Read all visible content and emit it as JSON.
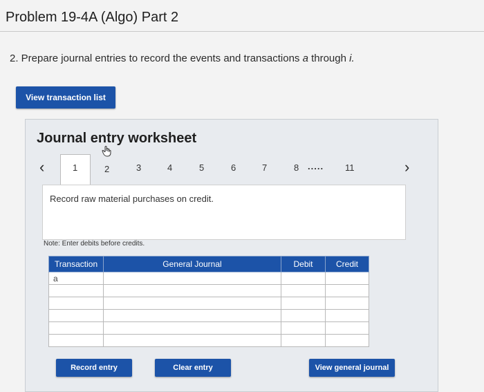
{
  "page": {
    "title": "Problem 19-4A (Algo) Part 2",
    "instruction_prefix": "2. Prepare journal entries to record the events and transactions ",
    "instruction_italic_a": "a",
    "instruction_middle": " through ",
    "instruction_italic_i": "i.",
    "view_transactions_label": "View transaction list"
  },
  "worksheet": {
    "title": "Journal entry worksheet",
    "pages": [
      "1",
      "2",
      "3",
      "4",
      "5",
      "6",
      "7",
      "8",
      ".....",
      "11"
    ],
    "active_page": "1",
    "prev_arrow": "‹",
    "next_arrow": "›",
    "prompt": "Record raw material purchases on credit.",
    "note": "Note: Enter debits before credits.",
    "table": {
      "headers": [
        "Transaction",
        "General Journal",
        "Debit",
        "Credit"
      ],
      "rows": [
        [
          "a",
          "",
          "",
          ""
        ],
        [
          "",
          "",
          "",
          ""
        ],
        [
          "",
          "",
          "",
          ""
        ],
        [
          "",
          "",
          "",
          ""
        ],
        [
          "",
          "",
          "",
          ""
        ],
        [
          "",
          "",
          "",
          ""
        ]
      ]
    },
    "buttons": {
      "record": "Record entry",
      "clear": "Clear entry",
      "view_general": "View general journal"
    }
  },
  "colors": {
    "primary": "#1c53a8",
    "worksheet_bg": "#e8ebef",
    "page_bg": "#f3f3f3"
  }
}
